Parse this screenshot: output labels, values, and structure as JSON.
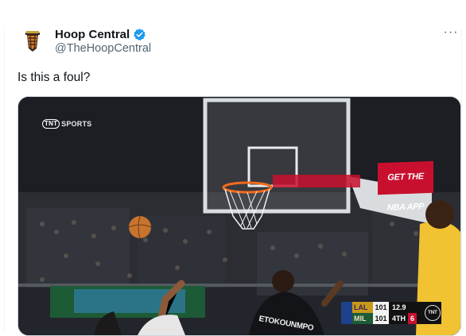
{
  "tweet": {
    "display_name": "Hoop Central",
    "handle": "@TheHoopCentral",
    "text": "Is this a foul?",
    "verified_icon": "verified-badge-icon",
    "more_icon": "more-options-icon",
    "more_label": "···"
  },
  "media": {
    "watermark_brand": "TNT",
    "watermark_text": "SPORTS",
    "ad_board_text": "GET THE NBA APP",
    "jersey_name": "ETOKOUNMPO",
    "scorebug": {
      "teams": [
        {
          "abbr": "LAL",
          "score": "101"
        },
        {
          "abbr": "MIL",
          "score": "101"
        }
      ],
      "clock": "12.9",
      "quarter": "4TH",
      "shot_clock": "6",
      "network": "TNT"
    }
  },
  "colors": {
    "text_primary": "#0f1419",
    "text_secondary": "#536471",
    "verified_blue": "#1d9bf0",
    "border": "#cfd9de"
  }
}
